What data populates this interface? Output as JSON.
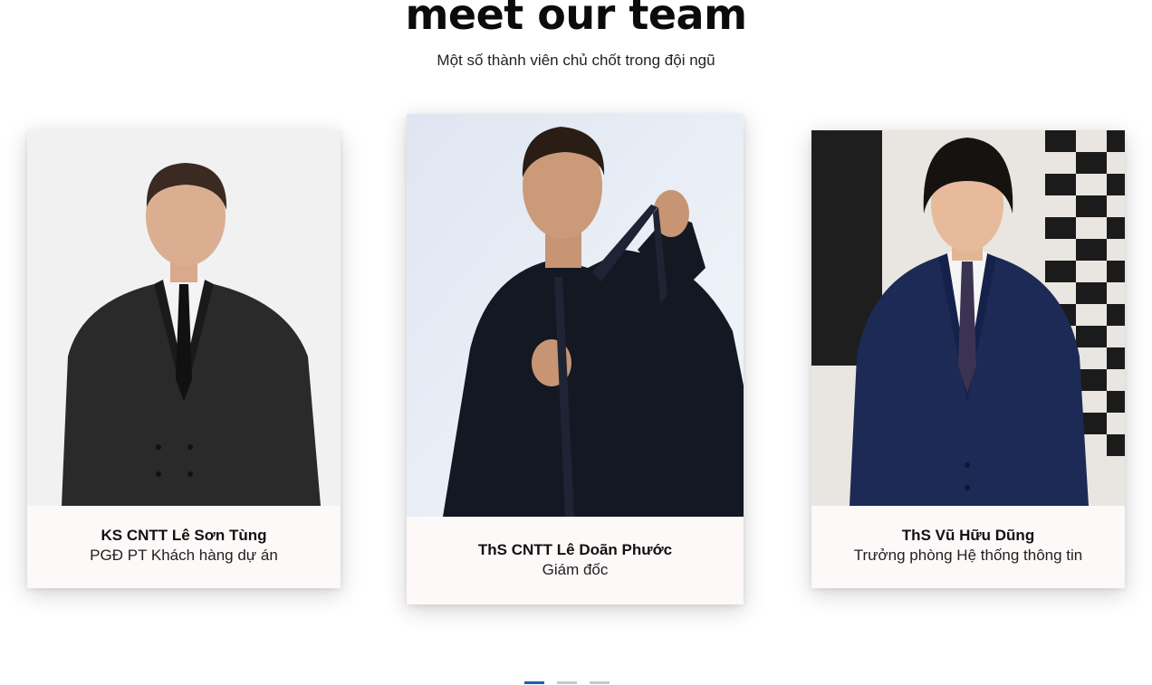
{
  "header": {
    "title": "meet our team",
    "subtitle": "Một số thành viên chủ chốt trong đội ngũ"
  },
  "team": [
    {
      "name": "KS CNTT Lê Sơn Tùng",
      "role": "PGĐ PT Khách hàng dự án"
    },
    {
      "name": "ThS CNTT Lê Doãn Phước",
      "role": "Giám đốc"
    },
    {
      "name": "ThS Vũ Hữu Dũng",
      "role": "Trưởng phòng Hệ thống thông tin"
    }
  ],
  "carousel": {
    "slide_count": 3,
    "active_index": 0,
    "active_color": "#1f5fa8",
    "inactive_color": "#c9c9c9"
  }
}
